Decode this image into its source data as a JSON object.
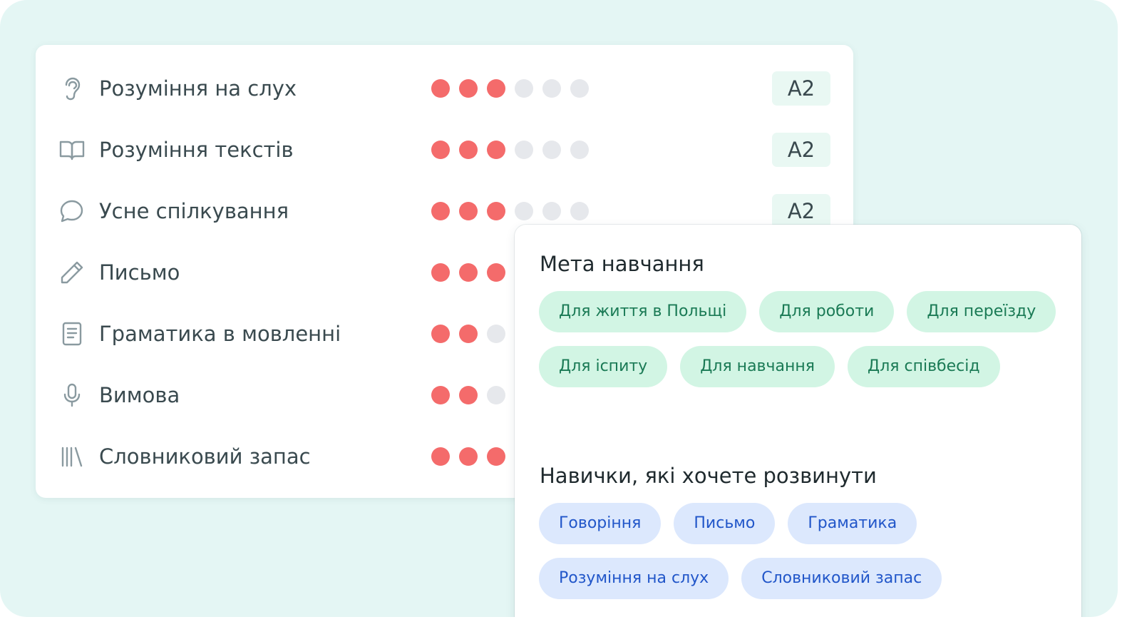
{
  "skills": [
    {
      "icon": "ear-icon",
      "label": "Розуміння на слух",
      "score": 3,
      "level": "A2"
    },
    {
      "icon": "open-book-icon",
      "label": "Розуміння текстів",
      "score": 3,
      "level": "A2"
    },
    {
      "icon": "speech-bubble-icon",
      "label": "Усне спілкування",
      "score": 3,
      "level": "A2"
    },
    {
      "icon": "pencil-icon",
      "label": "Письмо",
      "score": 3,
      "level": ""
    },
    {
      "icon": "notebook-icon",
      "label": "Граматика в мовленні",
      "score": 2,
      "level": ""
    },
    {
      "icon": "microphone-icon",
      "label": "Вимова",
      "score": 2,
      "level": ""
    },
    {
      "icon": "library-icon",
      "label": "Словниковий запас",
      "score": 3,
      "level": ""
    }
  ],
  "max_score": 6,
  "colors": {
    "background": "#e4f6f4",
    "dot_on": "#f46b6b",
    "dot_off": "#e6e8ec",
    "goal_chip": "#d2f5e4",
    "goal_text": "#1a7a55",
    "skill_chip": "#dce8fd",
    "skill_text": "#2156c9"
  },
  "goals": {
    "title": "Мета навчання",
    "rows": [
      [
        "Для життя в Польщі",
        "Для роботи",
        "Для переїзду"
      ],
      [
        "Для іспиту",
        "Для навчання",
        "Для співбесід"
      ]
    ]
  },
  "develop": {
    "title": "Навички, які хочете розвинути",
    "rows": [
      [
        "Говоріння",
        "Письмо",
        "Граматика"
      ],
      [
        "Розуміння на слух",
        "Словниковий запас"
      ]
    ]
  }
}
